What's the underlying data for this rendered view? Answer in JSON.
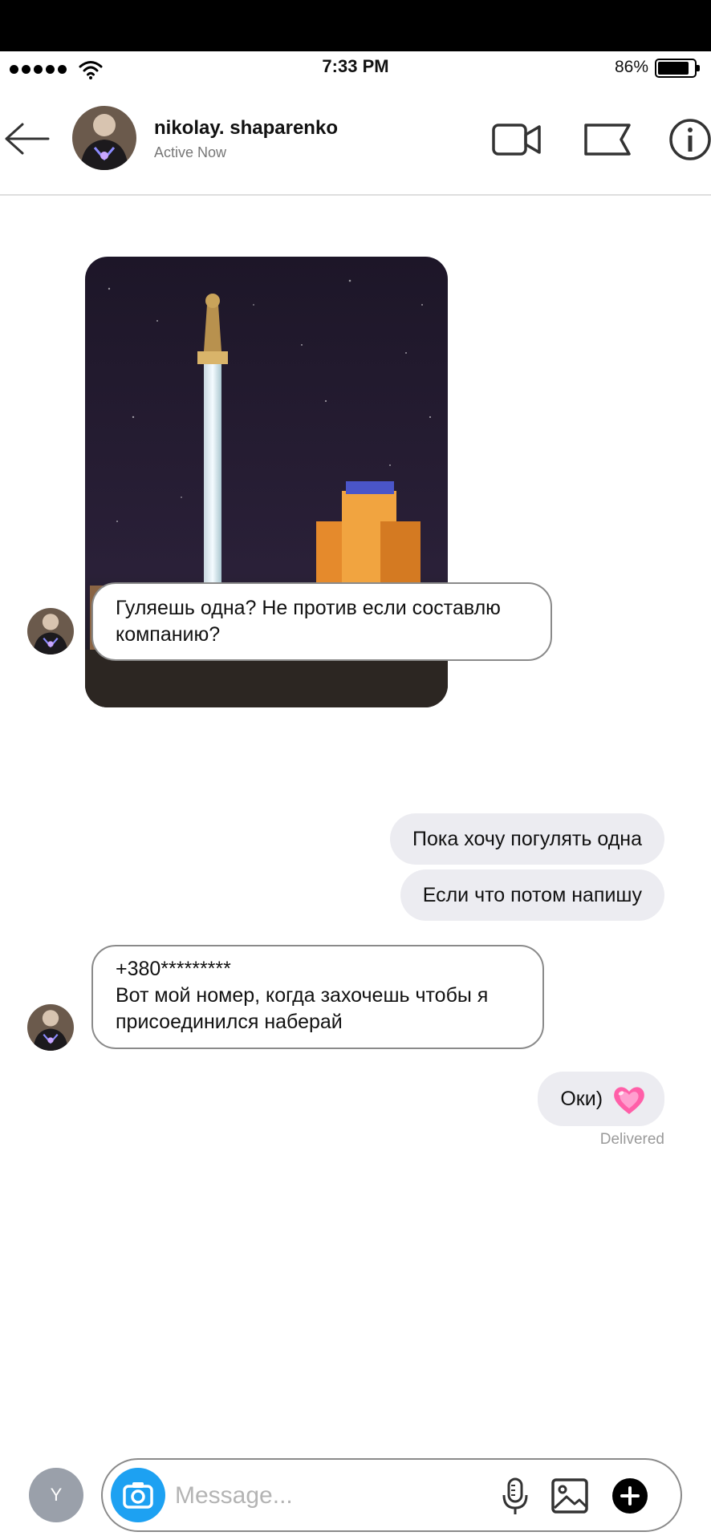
{
  "status_bar": {
    "time": "7:33 PM",
    "battery_percent": "86%",
    "battery_level": 0.86
  },
  "header": {
    "contact_name": "nikolay. shaparenko",
    "contact_status": "Active Now",
    "icons": [
      "back-arrow-icon",
      "video-call-icon",
      "flag-icon",
      "info-icon"
    ]
  },
  "messages": [
    {
      "type": "image",
      "from": "contact",
      "description_icon": "photo"
    },
    {
      "type": "text",
      "from": "contact",
      "text": "Гуляешь одна? Не против если составлю компанию?"
    },
    {
      "type": "text",
      "from": "me",
      "text": "Пока хочу погулять одна"
    },
    {
      "type": "text",
      "from": "me",
      "text": "Если что потом напишу"
    },
    {
      "type": "text",
      "from": "contact",
      "lines": [
        "+380*********",
        "Вот мой номер, когда захочешь чтобы я",
        "присоединился наберай"
      ]
    },
    {
      "type": "text",
      "from": "me",
      "text": "Оки)",
      "emoji": "pink-heart"
    }
  ],
  "receipt": "Delivered",
  "composer": {
    "user_initial": "Y",
    "placeholder": "Message...",
    "icons": [
      "camera-icon",
      "microphone-icon",
      "gallery-icon",
      "plus-icon"
    ]
  },
  "colors": {
    "camera_button": "#1da1f2",
    "outgoing_bubble": "#ececf1",
    "heart": "#ff5fa8"
  }
}
